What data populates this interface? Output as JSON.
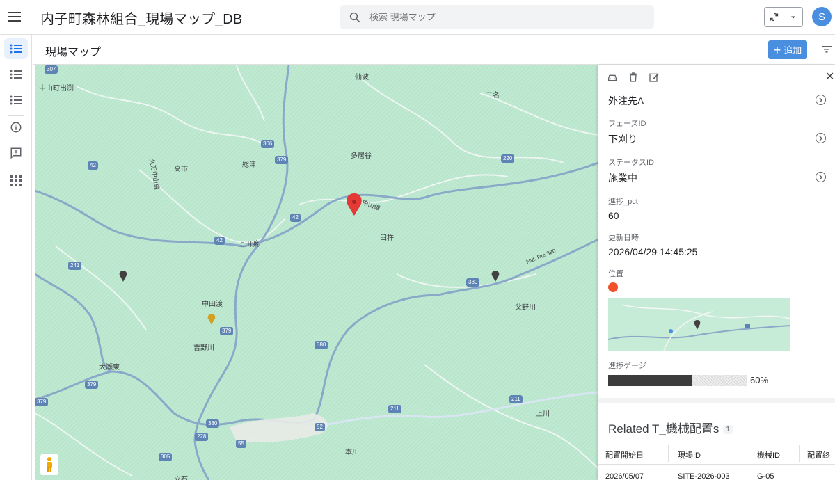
{
  "app": {
    "title": "内子町森林組合_現場マップ_DB",
    "avatar_letter": "S"
  },
  "search": {
    "placeholder": "検索 現場マップ"
  },
  "page": {
    "title": "現場マップ",
    "add_label": "追加"
  },
  "map": {
    "places": [
      {
        "label": "仙波"
      },
      {
        "label": "二名"
      },
      {
        "label": "中山町出渕"
      },
      {
        "label": "多居谷"
      },
      {
        "label": "高市"
      },
      {
        "label": "総津"
      },
      {
        "label": "上田渡"
      },
      {
        "label": "臼杵"
      },
      {
        "label": "中田渡"
      },
      {
        "label": "父野川"
      },
      {
        "label": "吉野川"
      },
      {
        "label": "大瀬東"
      },
      {
        "label": "上川"
      },
      {
        "label": "本川"
      },
      {
        "label": "立石"
      },
      {
        "label": "中山線"
      },
      {
        "label": "久万中山線"
      },
      {
        "label": "Nat. Rte 380"
      }
    ],
    "routes": [
      "307",
      "306",
      "379",
      "220",
      "42",
      "42",
      "42",
      "241",
      "380",
      "380",
      "379",
      "211",
      "211",
      "379",
      "380",
      "228",
      "55",
      "52",
      "305",
      "379"
    ],
    "marker_colors": {
      "selected": "#e53935",
      "default": "#424242",
      "yellow": "#d4a021"
    }
  },
  "detail": {
    "contractor": "外注先A",
    "phase_label": "フェーズID",
    "phase_value": "下刈り",
    "status_label": "ステータスID",
    "status_value": "施業中",
    "progress_label": "進捗_pct",
    "progress_value": "60",
    "updated_label": "更新日時",
    "updated_value": "2026/04/29 14:45:25",
    "location_label": "位置",
    "gauge_label": "進捗ゲージ",
    "gauge_pct": "60%",
    "gauge_fraction": 0.6
  },
  "related": {
    "title": "Related T_機械配置s",
    "count": "1",
    "columns": [
      "配置開始日",
      "現場ID",
      "機械ID",
      "配置終"
    ],
    "rows": [
      [
        "2026/05/07",
        "SITE-2026-003",
        "G-05",
        ""
      ]
    ]
  }
}
